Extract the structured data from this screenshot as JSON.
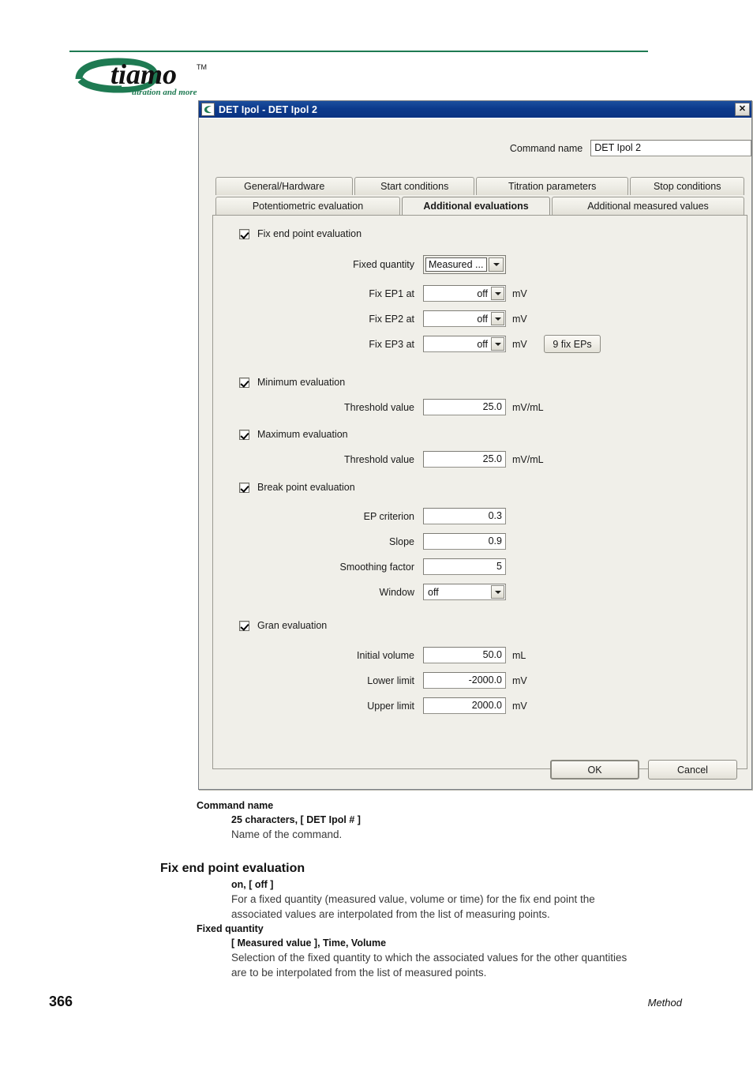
{
  "brand": {
    "name": "tiamo",
    "trademark": "TM",
    "tagline": "titration and more",
    "color": "#1e7a52"
  },
  "dialog": {
    "title": "DET Ipol - DET Ipol 2",
    "title_icon": "tiamo-app-icon",
    "close_label": "✕",
    "command_name_label": "Command name",
    "command_name_value": "DET Ipol 2",
    "tabs_row1": [
      {
        "label": "General/Hardware",
        "active": false
      },
      {
        "label": "Start conditions",
        "active": false
      },
      {
        "label": "Titration parameters",
        "active": false
      },
      {
        "label": "Stop conditions",
        "active": false
      }
    ],
    "tabs_row2": [
      {
        "label": "Potentiometric evaluation",
        "active": false
      },
      {
        "label": "Additional evaluations",
        "active": true
      },
      {
        "label": "Additional measured values",
        "active": false
      }
    ],
    "sections": {
      "fix_end_point": {
        "checkbox_label": "Fix end point evaluation",
        "checked": true,
        "fixed_quantity_label": "Fixed quantity",
        "fixed_quantity_value": "Measured ...",
        "fix_ep1_label": "Fix EP1 at",
        "fix_ep1_value": "off",
        "fix_ep1_unit": "mV",
        "fix_ep2_label": "Fix EP2 at",
        "fix_ep2_value": "off",
        "fix_ep2_unit": "mV",
        "fix_ep3_label": "Fix EP3 at",
        "fix_ep3_value": "off",
        "fix_ep3_unit": "mV",
        "more_eps_button": "9 fix EPs"
      },
      "minimum": {
        "checkbox_label": "Minimum evaluation",
        "checked": true,
        "threshold_label": "Threshold value",
        "threshold_value": "25.0",
        "threshold_unit": "mV/mL"
      },
      "maximum": {
        "checkbox_label": "Maximum evaluation",
        "checked": true,
        "threshold_label": "Threshold value",
        "threshold_value": "25.0",
        "threshold_unit": "mV/mL"
      },
      "break_point": {
        "checkbox_label": "Break point evaluation",
        "checked": true,
        "ep_criterion_label": "EP criterion",
        "ep_criterion_value": "0.3",
        "slope_label": "Slope",
        "slope_value": "0.9",
        "smoothing_label": "Smoothing factor",
        "smoothing_value": "5",
        "window_label": "Window",
        "window_value": "off"
      },
      "gran": {
        "checkbox_label": "Gran evaluation",
        "checked": true,
        "initial_volume_label": "Initial volume",
        "initial_volume_value": "50.0",
        "initial_volume_unit": "mL",
        "lower_limit_label": "Lower limit",
        "lower_limit_value": "-2000.0",
        "lower_limit_unit": "mV",
        "upper_limit_label": "Upper limit",
        "upper_limit_value": "2000.0",
        "upper_limit_unit": "mV"
      }
    },
    "ok_label": "OK",
    "cancel_label": "Cancel"
  },
  "doc": {
    "entry1": {
      "term": "Command name",
      "values": "25 characters, [ DET Ipol # ]",
      "desc": "Name of the command."
    },
    "heading": "Fix end point evaluation",
    "entry2": {
      "values": "on, [ off ]",
      "desc": "For a fixed quantity (measured value, volume or time) for the fix end point the associated values are interpolated from the list of measuring points."
    },
    "entry3": {
      "term": "Fixed quantity",
      "values": "[ Measured value ], Time, Volume",
      "desc": "Selection of the fixed quantity to which the associated values for the other quantities are to be interpolated from the list of measured points."
    }
  },
  "page_footer": {
    "page_number": "366",
    "section": "Method"
  }
}
